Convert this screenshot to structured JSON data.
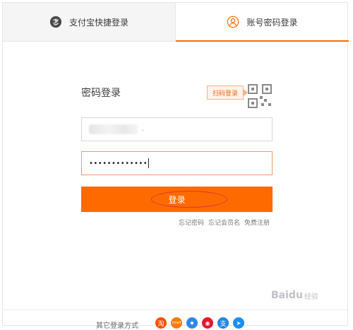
{
  "tabs": {
    "alipay_label": "支付宝快捷登录",
    "account_label": "账号密码登录"
  },
  "login": {
    "title": "密码登录",
    "scan_label": "扫码登录",
    "account_suffix": "-",
    "password_dots": "•••••••••••••",
    "submit_label": "登录",
    "links": [
      "忘记密码",
      "忘记会员名",
      "免费注册"
    ]
  },
  "bottom": {
    "other_label": "其它登录方式",
    "sns": [
      {
        "icon": "taobao-icon",
        "glyph": "淘",
        "color": "#ff5000"
      },
      {
        "icon": "tmall-icon",
        "glyph": "tmall",
        "color": "#ff7a00"
      },
      {
        "icon": "bird-icon",
        "glyph": "◆",
        "color": "#2f88e8"
      },
      {
        "icon": "weibo-icon",
        "glyph": "◉",
        "color": "#e6162d"
      },
      {
        "icon": "alipay-icon",
        "glyph": "支",
        "color": "#1e88e5"
      },
      {
        "icon": "send-icon",
        "glyph": "➤",
        "color": "#1b8ff2"
      }
    ]
  },
  "watermark": {
    "brand": "Baidu",
    "suffix": "经验"
  },
  "colors": {
    "accent": "#ff6a00"
  }
}
